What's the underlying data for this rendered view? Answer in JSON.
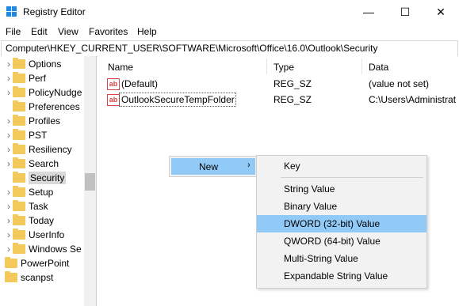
{
  "window": {
    "title": "Registry Editor",
    "minimize_glyph": "—",
    "maximize_glyph": "☐",
    "close_glyph": "✕"
  },
  "menu": [
    "File",
    "Edit",
    "View",
    "Favorites",
    "Help"
  ],
  "address": "Computer\\HKEY_CURRENT_USER\\SOFTWARE\\Microsoft\\Office\\16.0\\Outlook\\Security",
  "tree": [
    {
      "label": "Options",
      "expandable": true
    },
    {
      "label": "Perf",
      "expandable": true
    },
    {
      "label": "PolicyNudge",
      "expandable": true
    },
    {
      "label": "Preferences",
      "expandable": false
    },
    {
      "label": "Profiles",
      "expandable": true
    },
    {
      "label": "PST",
      "expandable": true
    },
    {
      "label": "Resiliency",
      "expandable": true
    },
    {
      "label": "Search",
      "expandable": true
    },
    {
      "label": "Security",
      "expandable": false,
      "selected": true
    },
    {
      "label": "Setup",
      "expandable": true
    },
    {
      "label": "Task",
      "expandable": true
    },
    {
      "label": "Today",
      "expandable": true
    },
    {
      "label": "UserInfo",
      "expandable": true
    },
    {
      "label": "Windows Se",
      "expandable": true
    },
    {
      "label": "PowerPoint",
      "expandable": false
    },
    {
      "label": "scanpst",
      "expandable": false
    }
  ],
  "columns": [
    "Name",
    "Type",
    "Data"
  ],
  "values": [
    {
      "name": "(Default)",
      "type": "REG_SZ",
      "data": "(value not set)",
      "icon": "string-value-icon"
    },
    {
      "name": "OutlookSecureTempFolder",
      "type": "REG_SZ",
      "data": "C:\\Users\\Administrat",
      "icon": "string-value-icon"
    }
  ],
  "context_menu": {
    "new_label": "New",
    "arrow": "›"
  },
  "new_submenu": {
    "key": "Key",
    "items": [
      "String Value",
      "Binary Value",
      "DWORD (32-bit) Value",
      "QWORD (64-bit) Value",
      "Multi-String Value",
      "Expandable String Value"
    ],
    "hovered": "DWORD (32-bit) Value"
  },
  "colors": {
    "hover": "#91c9f7",
    "folder": "#f2c95a",
    "selection": "#d9d9d9"
  }
}
